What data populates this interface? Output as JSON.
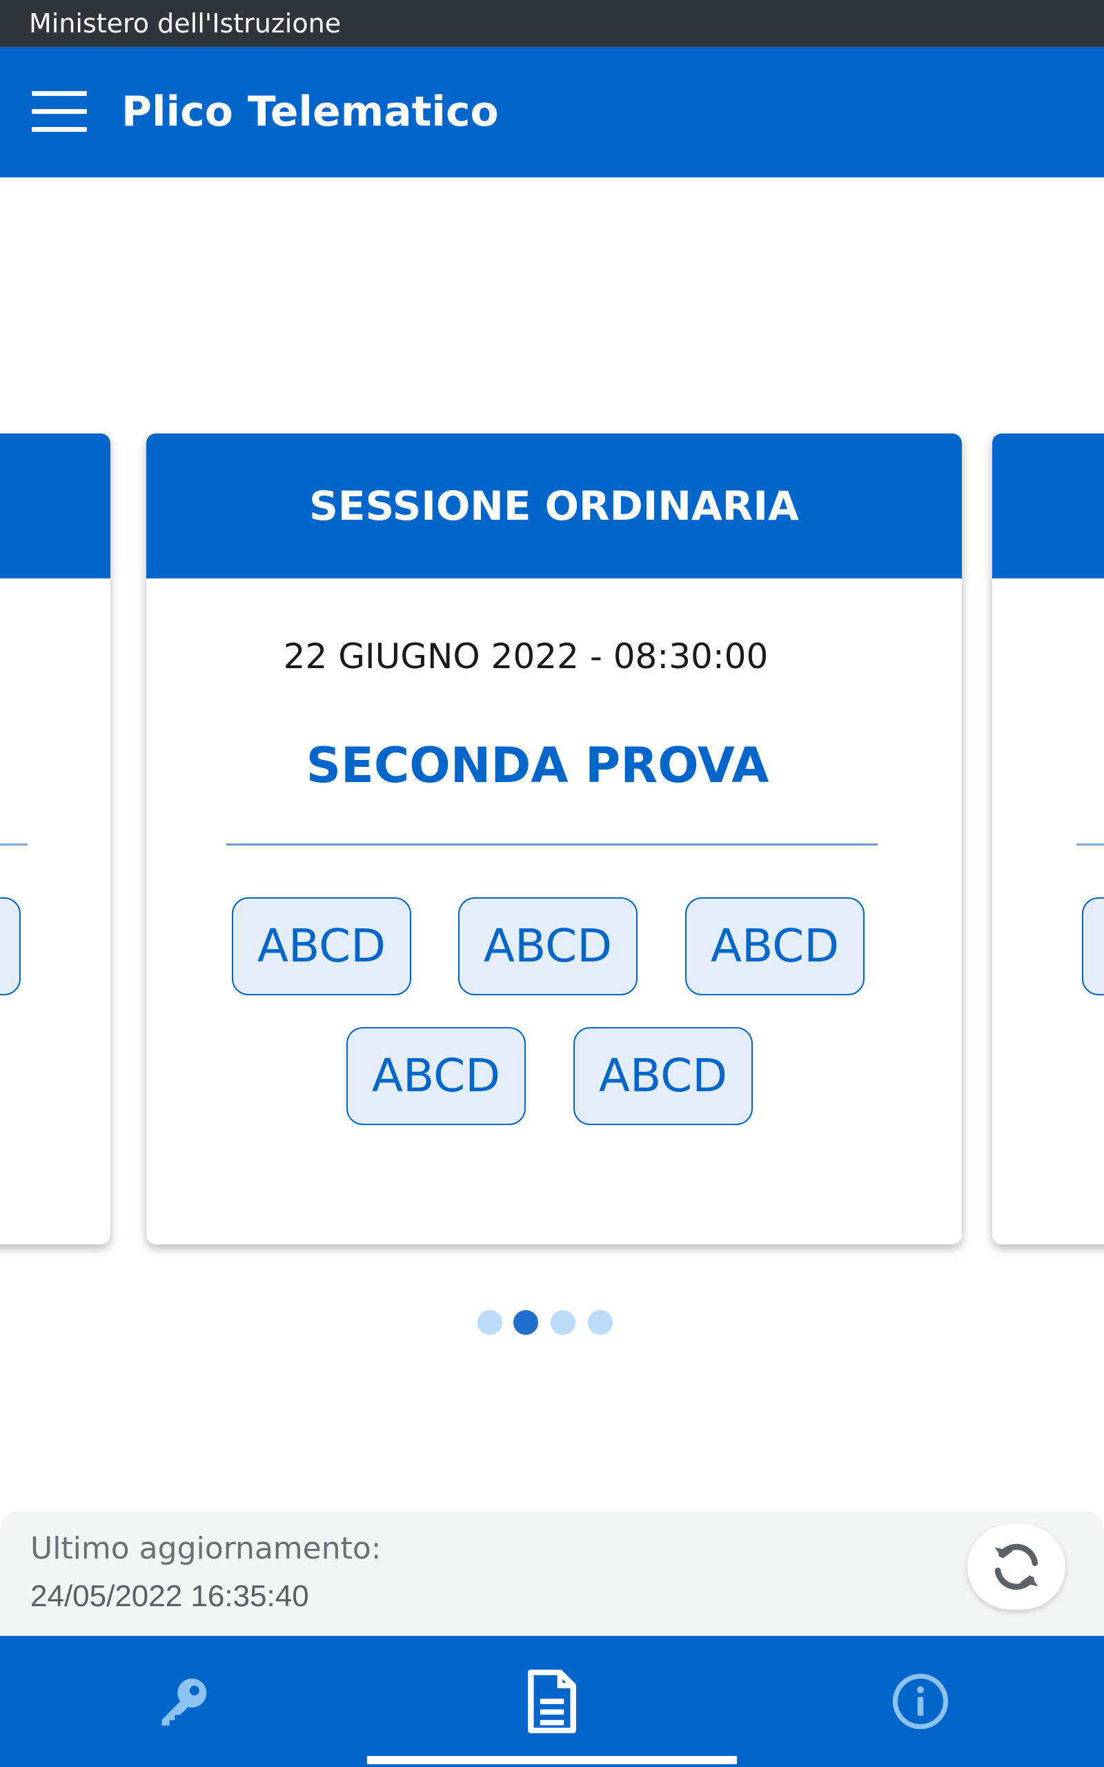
{
  "status_bar": {
    "carrier": "Ministero dell'Istruzione"
  },
  "app_bar": {
    "title": "Plico Telematico",
    "menu_icon": "hamburger-menu-icon"
  },
  "carousel": {
    "active_card": {
      "header": "SESSIONE ORDINARIA",
      "date": "22 GIUGNO 2022 - 08:30:00",
      "subject": "SECONDA PROVA",
      "codes": [
        "ABCD",
        "ABCD",
        "ABCD",
        "ABCD",
        "ABCD"
      ]
    },
    "page_count": 4,
    "active_page": 2
  },
  "update": {
    "label": "Ultimo aggiornamento:",
    "timestamp": "24/05/2022 16:35:40",
    "refresh_icon": "refresh-icon"
  },
  "bottom_nav": {
    "tabs": [
      {
        "icon": "key-icon",
        "active": false
      },
      {
        "icon": "document-icon",
        "active": true
      },
      {
        "icon": "info-icon",
        "active": false
      }
    ]
  },
  "colors": {
    "primary": "#0066cc",
    "status_bar": "#2f353b",
    "chip_fill": "#e3eefa",
    "dot_inactive": "#bcdcfa",
    "dot_active": "#1e70cc",
    "panel": "#f3f4f4"
  }
}
